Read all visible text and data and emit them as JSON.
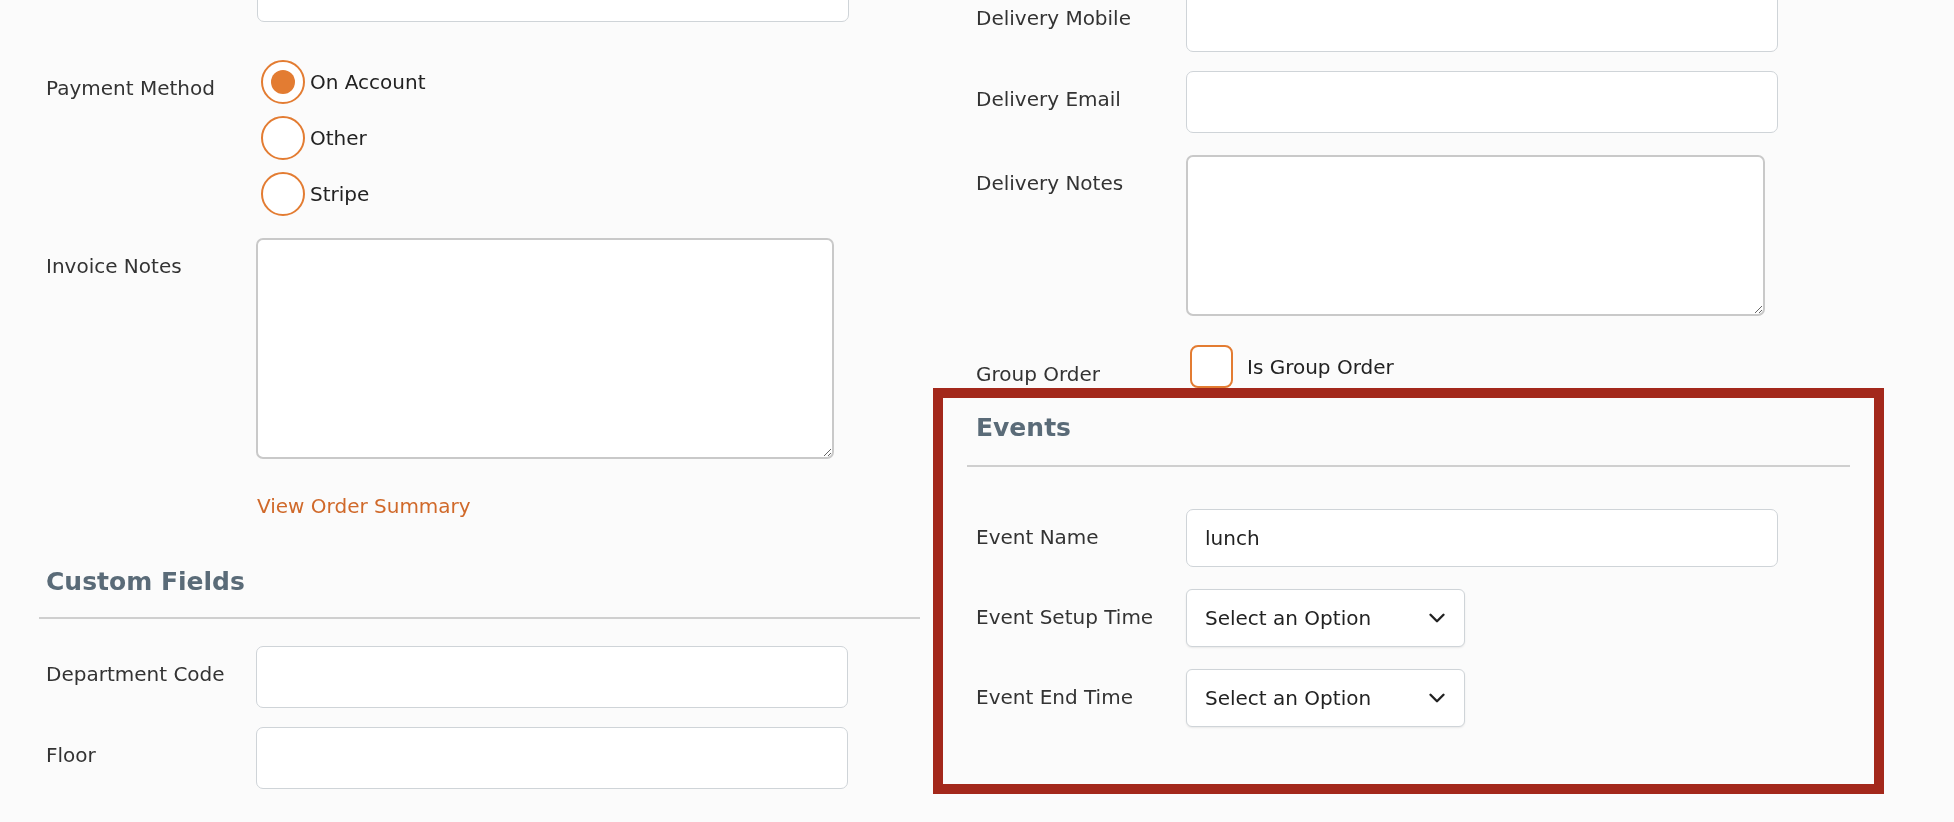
{
  "left_column": {
    "fields": [
      {
        "kind": "input"
      },
      {
        "kind": "radio_group",
        "label": "Payment Method",
        "options": [
          {
            "label": "On Account",
            "selected": true
          },
          {
            "label": "Other",
            "selected": false
          },
          {
            "label": "Stripe",
            "selected": false
          }
        ]
      },
      {
        "kind": "textarea",
        "label": "Invoice Notes"
      }
    ],
    "link": "View Order Summary",
    "custom_fields": {
      "title": "Custom Fields",
      "fields": [
        {
          "kind": "input",
          "label": "Department Code"
        },
        {
          "kind": "input",
          "label": "Floor"
        }
      ]
    }
  },
  "right_column": {
    "fields": [
      {
        "kind": "input",
        "label": "Delivery Mobile"
      },
      {
        "kind": "input",
        "label": "Delivery Email"
      },
      {
        "kind": "textarea",
        "label": "Delivery Notes"
      },
      {
        "kind": "checkbox",
        "label": "Group Order",
        "option": "Is Group Order",
        "checked": false
      }
    ],
    "events": {
      "title": "Events",
      "fields": [
        {
          "kind": "input",
          "label": "Event Name",
          "value": "lunch"
        },
        {
          "kind": "select",
          "label": "Event Setup Time",
          "placeholder": "Select an Option"
        },
        {
          "kind": "select",
          "label": "Event End Time",
          "placeholder": "Select an Option"
        }
      ]
    }
  }
}
